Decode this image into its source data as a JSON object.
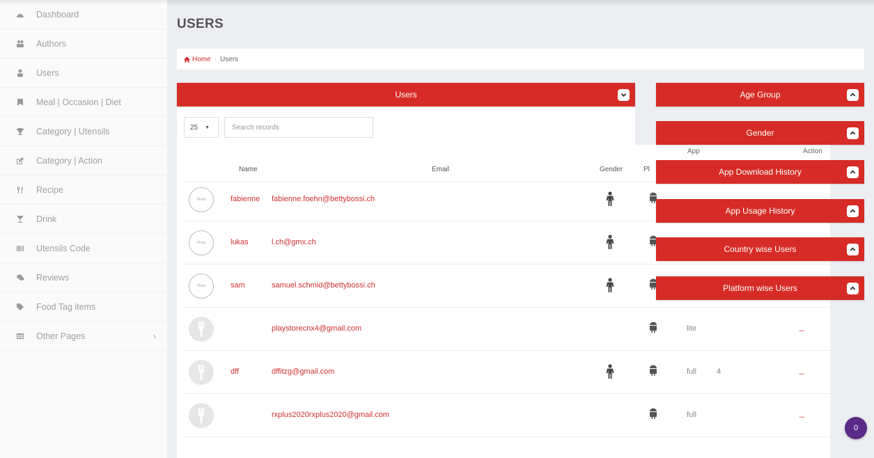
{
  "sidebar": {
    "items": [
      {
        "label": "Dashboard",
        "icon": "dashboard-icon"
      },
      {
        "label": "Authors",
        "icon": "authors-icon"
      },
      {
        "label": "Users",
        "icon": "user-icon"
      },
      {
        "label": "Meal | Occasion | Diet",
        "icon": "bookmark-icon"
      },
      {
        "label": "Category | Utensils",
        "icon": "trophy-icon"
      },
      {
        "label": "Category | Action",
        "icon": "edit-icon"
      },
      {
        "label": "Recipe",
        "icon": "cutlery-icon"
      },
      {
        "label": "Drink",
        "icon": "glass-icon"
      },
      {
        "label": "Utensils Code",
        "icon": "barcode-icon"
      },
      {
        "label": "Reviews",
        "icon": "comments-icon"
      },
      {
        "label": "Food Tag items",
        "icon": "tag-icon"
      },
      {
        "label": "Other Pages",
        "icon": "table-icon",
        "chevron": "›"
      }
    ]
  },
  "page": {
    "title": "USERS",
    "breadcrumb": {
      "home": "Home",
      "separator": "·",
      "current": "Users"
    }
  },
  "users_panel": {
    "title": "Users",
    "page_length": "25",
    "page_length_caret": "▼",
    "search_placeholder": "Search records",
    "columns": {
      "name": "Name",
      "email": "Email",
      "gender": "Gender",
      "platform": "Pl"
    },
    "rows": [
      {
        "photo": "Photo",
        "name": "fabienne",
        "email": "fabienne.foehn@bettybossi.ch",
        "gender": "male",
        "platform": "android",
        "app": "",
        "version": ""
      },
      {
        "photo": "Photo",
        "name": "lukas",
        "email": "l.ch@gmx.ch",
        "gender": "male",
        "platform": "android",
        "app": "",
        "version": ""
      },
      {
        "photo": "Photo",
        "name": "sam",
        "email": "samuel.schmid@bettybossi.ch",
        "gender": "male",
        "platform": "android",
        "app": "",
        "version": ""
      },
      {
        "photo": "",
        "name": "",
        "email": "playstorecnx4@gmail.com",
        "gender": "",
        "platform": "android",
        "app": "lite",
        "version": "",
        "dots": "..."
      },
      {
        "photo": "",
        "name": "dff",
        "email": "dffitzg@gmail.com",
        "gender": "male",
        "platform": "android",
        "app": "full",
        "version": "4",
        "dots": "..."
      },
      {
        "photo": "",
        "name": "",
        "email": "rxplus2020rxplus2020@gmail.com",
        "gender": "",
        "platform": "android",
        "app": "full",
        "version": "",
        "dots": "..."
      }
    ]
  },
  "right_panels": [
    {
      "title": "Age Group"
    },
    {
      "title": "Gender"
    },
    {
      "title": "App Download History"
    },
    {
      "title": "App Usage History"
    },
    {
      "title": "Country wise Users"
    },
    {
      "title": "Platform wise Users"
    }
  ],
  "right_columns": {
    "app": "App",
    "action": "Action"
  },
  "notification_badge": "0",
  "colors": {
    "accent": "#d62b26",
    "link": "#d32f2f",
    "badge": "#5b2a86"
  }
}
